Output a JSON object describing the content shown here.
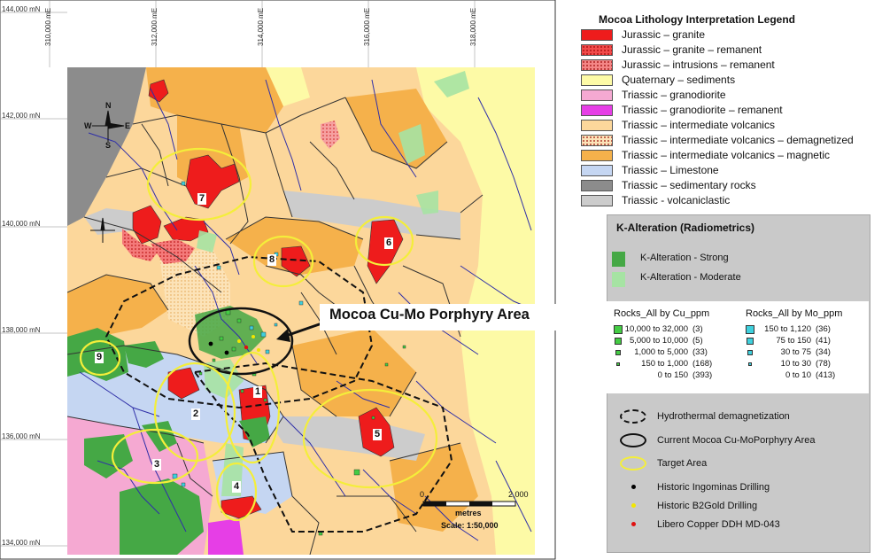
{
  "map": {
    "coords_top": [
      "310,000 mE",
      "312,000 mE",
      "314,000 mE",
      "316,000 mE",
      "318,000 mE"
    ],
    "coords_left": [
      "144,000 mN",
      "142,000 mN",
      "140,000 mN",
      "138,000 mN",
      "136,000 mN",
      "134,000 mN"
    ],
    "compass": {
      "n": "N",
      "s": "S",
      "e": "E",
      "w": "W"
    },
    "targets": [
      "1",
      "2",
      "3",
      "4",
      "5",
      "6",
      "7",
      "8",
      "9"
    ],
    "callout": "Mocoa Cu-Mo Porphyry Area",
    "scale": {
      "zero": "0",
      "max": "2,000",
      "unit": "metres",
      "ratio": "Scale: 1:50,000"
    },
    "colors": {
      "granite": "#ee1c1c",
      "quaternary": "#fdfaa6",
      "volcanics": "#fcd79b",
      "magnetic": "#f5b14b",
      "limestone": "#c5d6f2",
      "sedimentary": "#8c8c8c",
      "volcaniclastic": "#cccccc",
      "granodiorite": "#f5a9d2",
      "k_strong": "#45a845",
      "k_moderate": "#a6e3a3",
      "drainage": "#2f2fa8"
    }
  },
  "legend": {
    "title": "Mocoa Lithology Interpretation Legend",
    "items": [
      {
        "label": "Jurassic – granite",
        "color": "#ee1c1c",
        "pattern": "solid"
      },
      {
        "label": "Jurassic – granite – remanent",
        "color": "#f24b4b",
        "pattern": "dots"
      },
      {
        "label": "Jurassic – intrusions – remanent",
        "color": "#f48686",
        "pattern": "dots"
      },
      {
        "label": "Quaternary – sediments",
        "color": "#fdfaa6",
        "pattern": "solid"
      },
      {
        "label": "Triassic – granodiorite",
        "color": "#f5a9d2",
        "pattern": "solid"
      },
      {
        "label": "Triassic – granodiorite – remanent",
        "color": "#e63ee6",
        "pattern": "solid"
      },
      {
        "label": "Triassic – intermediate volcanics",
        "color": "#fcd79b",
        "pattern": "solid"
      },
      {
        "label": "Triassic – intermediate volcanics – demagnetized",
        "color": "#fce3b8",
        "pattern": "dots"
      },
      {
        "label": "Triassic – intermediate volcanics – magnetic",
        "color": "#f5b14b",
        "pattern": "solid"
      },
      {
        "label": "Triassic – Limestone",
        "color": "#c5d6f2",
        "pattern": "solid"
      },
      {
        "label": "Triassic – sedimentary rocks",
        "color": "#8c8c8c",
        "pattern": "solid"
      },
      {
        "label": "Triassic - volcaniclastic",
        "color": "#cccccc",
        "pattern": "solid"
      }
    ]
  },
  "kalteration": {
    "title": "K-Alteration (Radiometrics)",
    "strong": {
      "label": "K-Alteration - Strong",
      "color": "#45a845"
    },
    "moderate": {
      "label": "K-Alteration - Moderate",
      "color": "#a6e3a3"
    }
  },
  "rocks_cu": {
    "title": "Rocks_All by Cu_ppm",
    "color": "#44cc44",
    "rows": [
      {
        "range": "10,000 to 32,000",
        "count": "(3)"
      },
      {
        "range": "5,000 to 10,000",
        "count": "(5)"
      },
      {
        "range": "1,000 to 5,000",
        "count": "(33)"
      },
      {
        "range": "150 to 1,000",
        "count": "(168)"
      },
      {
        "range": "0 to 150",
        "count": "(393)"
      }
    ]
  },
  "rocks_mo": {
    "title": "Rocks_All by Mo_ppm",
    "color": "#3fd0dd",
    "rows": [
      {
        "range": "150 to 1,120",
        "count": "(36)"
      },
      {
        "range": "75 to 150",
        "count": "(41)"
      },
      {
        "range": "30 to 75",
        "count": "(34)"
      },
      {
        "range": "10 to 30",
        "count": "(78)"
      },
      {
        "range": "0 to 10",
        "count": "(413)"
      }
    ]
  },
  "symbols": [
    {
      "label": "Hydrothermal  demagnetization",
      "kind": "dashed-ellipse"
    },
    {
      "label": "Current Mocoa Cu-MoPorphyry Area",
      "kind": "black-ellipse"
    },
    {
      "label": "Target Area",
      "kind": "yellow-ellipse"
    },
    {
      "label": "Historic Ingominas Drilling",
      "kind": "dot",
      "color": "#000000"
    },
    {
      "label": "Historic B2Gold Drilling",
      "kind": "dot",
      "color": "#f2e600"
    },
    {
      "label": "Libero Copper DDH MD-043",
      "kind": "dot",
      "color": "#e01010"
    }
  ]
}
